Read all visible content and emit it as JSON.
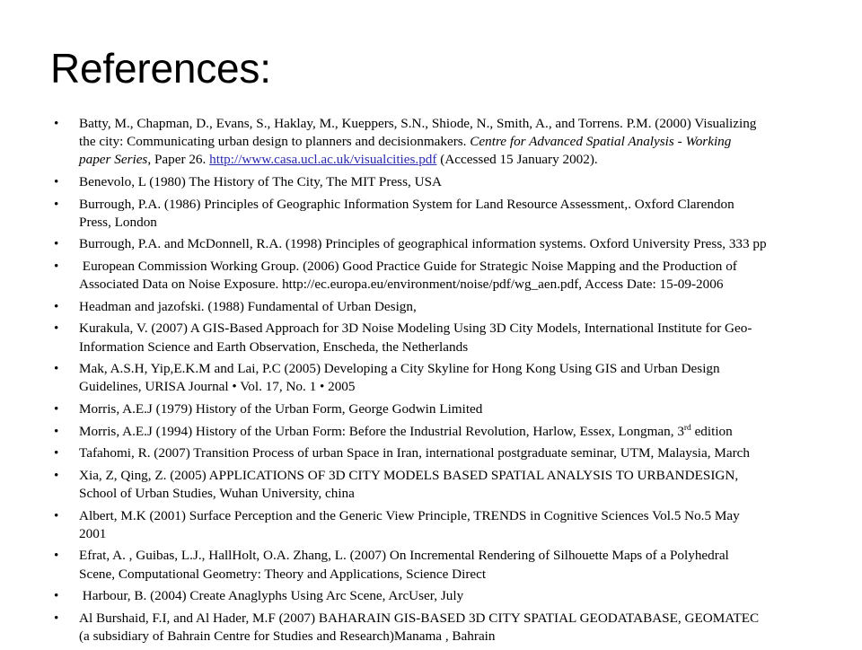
{
  "slide": {
    "title": "References:",
    "bullet_glyph": "•",
    "link_color": "#2a2ab0",
    "text_color": "#000000",
    "background_color": "#ffffff"
  },
  "references": [
    {
      "id": "batty-2000",
      "lines": [
        "Batty, M., Chapman, D., Evans, S., Haklay, M., Kueppers, S.N., Shiode, N., Smith, A., and Torrens. P.M. (2000) Visualizing",
        "the city: Communicating urban design to planners and decisionmakers. ",
        "paper Series",
        ", Paper 26. ",
        "http://www.casa.ucl.ac.uk/visualcities.pdf",
        " (Accessed 15 January 2002)."
      ],
      "line1": "Batty, M., Chapman, D., Evans, S., Haklay, M., Kueppers, S.N., Shiode, N., Smith, A., and Torrens. P.M. (2000) Visualizing",
      "line2_pre": "the city: Communicating urban design to planners and decisionmakers. ",
      "line2_italic": "Centre for Advanced Spatial Analysis - Working",
      "line3_italic": "paper Series",
      "line3_mid": ", Paper 26. ",
      "line3_link": "http://www.casa.ucl.ac.uk/visualcities.pdf",
      "line3_post": " (Accessed 15 January 2002)."
    },
    {
      "id": "benevolo-1980",
      "line1": "Benevolo, L (1980) The History of The City, The MIT Press, USA"
    },
    {
      "id": "burrough-1986",
      "line1": "Burrough, P.A. (1986) Principles of Geographic Information System for Land Resource Assessment,. Oxford Clarendon",
      "line2": "Press, London"
    },
    {
      "id": "burrough-mcdonnell-1998",
      "line1": "Burrough, P.A. and McDonnell, R.A. (1998) Principles of geographical information systems. Oxford University Press, 333 pp"
    },
    {
      "id": "european-commission-2006",
      "line1": " European Commission Working Group. (2006) Good Practice Guide for Strategic Noise Mapping and the Production of",
      "line2": "Associated Data on Noise Exposure. http://ec.europa.eu/environment/noise/pdf/wg_aen.pdf, Access Date: 15-09-2006"
    },
    {
      "id": "headman-jazofski-1988",
      "line1": "Headman and jazofski. (1988) Fundamental of Urban Design,"
    },
    {
      "id": "kurakula-2007",
      "line1": "Kurakula, V. (2007) A GIS-Based Approach for 3D Noise Modeling Using 3D City Models, International Institute for Geo-",
      "line2": "Information Science and Earth Observation, Enscheda, the Netherlands"
    },
    {
      "id": "mak-2005",
      "line1": "Mak, A.S.H, Yip,E.K.M and Lai, P.C (2005) Developing a City Skyline for Hong Kong Using GIS and Urban Design",
      "line2": "Guidelines, URISA Journal • Vol. 17, No. 1 • 2005"
    },
    {
      "id": "morris-1979",
      "line1": "Morris, A.E.J (1979) History of the Urban Form, George Godwin Limited"
    },
    {
      "id": "morris-1994",
      "line1_pre": "Morris, A.E.J (1994) History of the Urban Form: Before the Industrial Revolution, Harlow, Essex, Longman, 3",
      "line1_sup": "rd",
      "line1_post": " edition"
    },
    {
      "id": "tafahomi-2007",
      "line1": "Tafahomi, R. (2007) Transition Process of urban Space in Iran, international postgraduate seminar, UTM, Malaysia, March"
    },
    {
      "id": "xia-qing-2005",
      "line1": "Xia, Z, Qing, Z. (2005) APPLICATIONS OF 3D CITY MODELS BASED SPATIAL ANALYSIS TO URBANDESIGN,",
      "line2": "School of Urban Studies, Wuhan University, china"
    },
    {
      "id": "albert-2001",
      "line1": "Albert, M.K (2001) Surface Perception and the Generic View Principle, TRENDS in Cognitive Sciences Vol.5 No.5 May",
      "line2": "2001"
    },
    {
      "id": "efrat-2007",
      "line1": "Efrat, A. , Guibas, L.J., HallHolt, O.A. Zhang, L. (2007) On Incremental Rendering of Silhouette Maps of a Polyhedral",
      "line2": "Scene, Computational Geometry: Theory and Applications, Science Direct"
    },
    {
      "id": "harbour-2004",
      "line1": " Harbour, B. (2004) Create Anaglyphs Using Arc Scene, ArcUser, July"
    },
    {
      "id": "al-burshaid-2007",
      "line1": "Al Burshaid, F.I, and Al Hader, M.F (2007) BAHARAIN GIS-BASED 3D CITY SPATIAL GEODATABASE, GEOMATEC",
      "line2": "(a subsidiary of Bahrain Centre for Studies and Research)Manama , Bahrain"
    }
  ]
}
